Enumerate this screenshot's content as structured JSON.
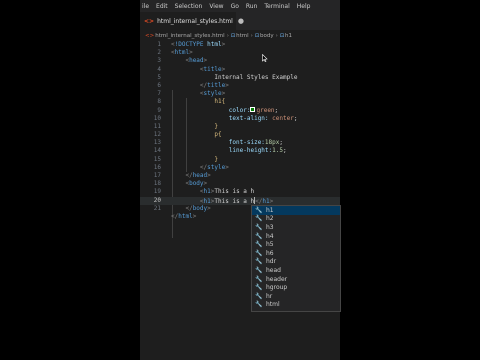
{
  "menu": [
    "ile",
    "Edit",
    "Selection",
    "View",
    "Go",
    "Run",
    "Terminal",
    "Help"
  ],
  "tab": {
    "label": "html_internal_styles.html",
    "file_icon": "html-file-icon"
  },
  "breadcrumb": [
    "html_internal_styles.html",
    "html",
    "body",
    "h1"
  ],
  "line_numbers": [
    "1",
    "2",
    "3",
    "4",
    "5",
    "6",
    "7",
    "8",
    "9",
    "10",
    "11",
    "12",
    "13",
    "14",
    "15",
    "16",
    "17",
    "18",
    "19",
    "20",
    "21"
  ],
  "code": {
    "l1_lt": "<",
    "l1_doctype": "!DOCTYPE",
    "l1_html": " html",
    "l1_gt": ">",
    "html_open": "html",
    "head_open": "head",
    "title_open": "title",
    "title_text": "Internal Styles Example",
    "title_close": "title",
    "style_open": "style",
    "h1_selector": "h1{",
    "color_prop": "color:",
    "color_val": "green",
    "semi1": ";",
    "text_align_prop": "text-align:",
    "text_align_val": " center",
    "semi2": ";",
    "close_brace1": "}",
    "p_selector": "p{",
    "font_size_prop": "font-size:",
    "font_size_val": "18px",
    "semi3": ";",
    "line_height_prop": "line-height:",
    "line_height_val": "1.5",
    "semi4": ";",
    "close_brace2": "}",
    "style_close": "style",
    "head_close": "head",
    "body_open": "body",
    "h1_tag": "h1",
    "h1_text": "This is a h",
    "h1_close_tag": "h1",
    "body_close": "body",
    "html_close": "html"
  },
  "suggestions": [
    "h1",
    "h2",
    "h3",
    "h4",
    "h5",
    "h6",
    "hdr",
    "head",
    "header",
    "hgroup",
    "hr",
    "html"
  ],
  "selected_suggestion": "h1",
  "colors": {
    "editor_bg": "#1e1e1e",
    "tag": "#569cd6",
    "selection": "#04395e"
  }
}
